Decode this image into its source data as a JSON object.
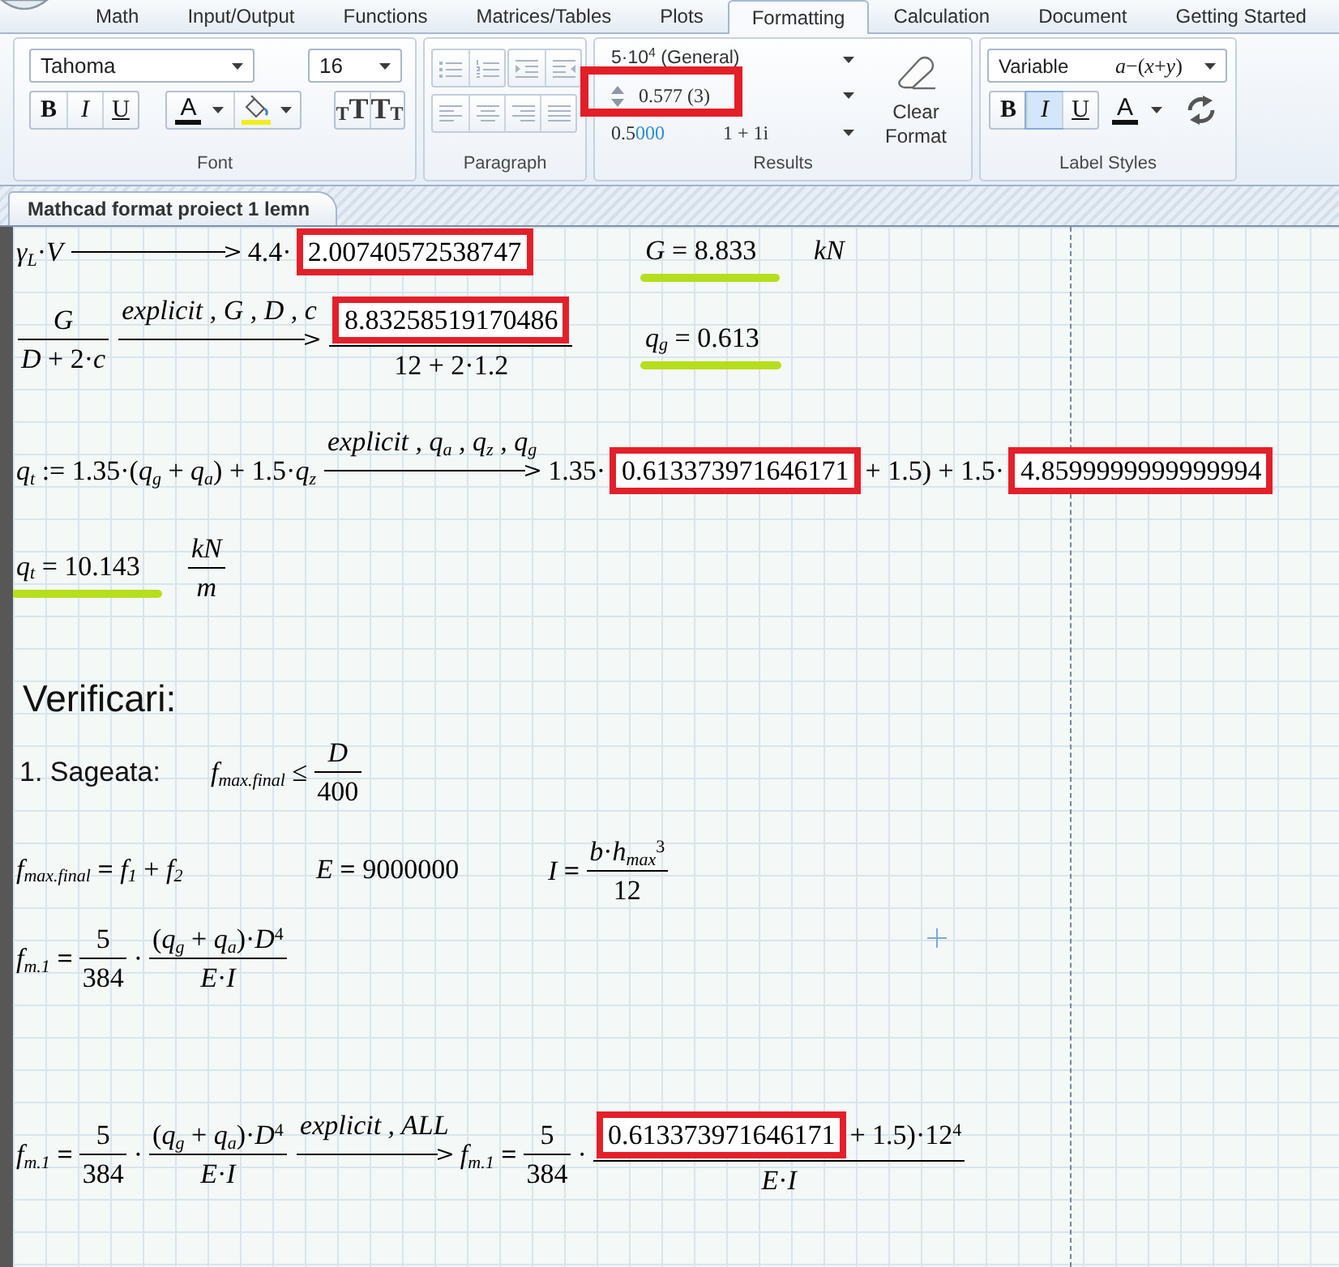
{
  "ribbon_tabs": [
    {
      "label": "Math",
      "selected": false
    },
    {
      "label": "Input/Output",
      "selected": false
    },
    {
      "label": "Functions",
      "selected": false
    },
    {
      "label": "Matrices/Tables",
      "selected": false
    },
    {
      "label": "Plots",
      "selected": false
    },
    {
      "label": "Formatting",
      "selected": true
    },
    {
      "label": "Calculation",
      "selected": false
    },
    {
      "label": "Document",
      "selected": false
    },
    {
      "label": "Getting Started",
      "selected": false
    }
  ],
  "ribbon": {
    "font": {
      "label": "Font",
      "font_name": "Tahoma",
      "font_size": "16",
      "styles": [
        {
          "kind": "bold",
          "label": "B",
          "on": false
        },
        {
          "kind": "italic",
          "label": "I",
          "on": false
        },
        {
          "kind": "underline",
          "label": "U",
          "on": false
        }
      ],
      "color_label": "A",
      "size_buttons": [
        {
          "kind": "grow",
          "label": "TT"
        },
        {
          "kind": "shrink",
          "label": "TT"
        }
      ]
    },
    "paragraph": {
      "label": "Paragraph",
      "disabled": true
    },
    "results": {
      "label": "Results",
      "format": "5·10$^{4}$ (General)",
      "precision": {
        "text": "0.577 (3)",
        "annotated": true
      },
      "sample": {
        "value": "0.5",
        "trailing_zeros": "000",
        "complex": "1 + 1i"
      },
      "clear_button": "Clear Format"
    },
    "label_styles": {
      "label": "Label Styles",
      "style_name": "Variable",
      "sample": "*a*−(*x*+*y*)",
      "styles": [
        {
          "kind": "bold",
          "label": "B",
          "on": false
        },
        {
          "kind": "italic",
          "label": "I",
          "on": true
        },
        {
          "kind": "underline",
          "label": "U",
          "on": false
        }
      ],
      "color_label": "A"
    }
  },
  "document_tab": {
    "title": "Mathcad format proiect 1 lemn"
  },
  "worksheet": {
    "rows": [
      {
        "regions": [
          {
            "kind": "math",
            "underlined": false,
            "parts": [
              {
                "kind": "t",
                "text": "*γ*$_{L}$·*V*"
              },
              {
                "kind": "arrow"
              },
              {
                "kind": "t",
                "text": "4.4·"
              },
              {
                "kind": "boxed",
                "text": "2.00740572538747"
              }
            ]
          },
          {
            "kind": "math",
            "underlined": true,
            "parts": [
              {
                "kind": "t",
                "text": "*G* = 8.833"
              }
            ]
          },
          {
            "kind": "math",
            "underlined": false,
            "parts": [
              {
                "kind": "var",
                "text": "kN"
              }
            ]
          }
        ]
      },
      {
        "regions": [
          {
            "kind": "math",
            "underlined": false,
            "parts": [
              {
                "kind": "frac",
                "num": [
                  {
                    "kind": "var",
                    "text": "G"
                  }
                ],
                "den": [
                  {
                    "kind": "t",
                    "text": "*D* + 2·*c*"
                  }
                ]
              },
              {
                "kind": "arrow",
                "label": "explicit , *G* , *D* , *c*"
              },
              {
                "kind": "frac",
                "num": [
                  {
                    "kind": "boxed",
                    "text": "8.83258519170486"
                  }
                ],
                "den": [
                  {
                    "kind": "t",
                    "text": "12 + 2·1.2"
                  }
                ]
              }
            ]
          },
          {
            "kind": "math",
            "underlined": true,
            "parts": [
              {
                "kind": "t",
                "text": "*q*$_{g}$ = 0.613"
              }
            ]
          }
        ]
      },
      {
        "regions": [
          {
            "kind": "math",
            "underlined": false,
            "parts": [
              {
                "kind": "t",
                "text": "*q*$_{t}$ := 1.35·(*q*$_{g}$ + *q*$_{a}$) + 1.5·*q*$_{z}$"
              },
              {
                "kind": "arrow",
                "label": "explicit , *q*$_{a}$ , *q*$_{z}$ , *q*$_{g}$"
              },
              {
                "kind": "t",
                "text": "1.35·"
              },
              {
                "kind": "boxed",
                "text": "0.613373971646171"
              },
              {
                "kind": "t",
                "text": "+ 1.5) + 1.5·"
              },
              {
                "kind": "boxed",
                "text": "4.8599999999999994"
              }
            ]
          }
        ]
      },
      {
        "regions": [
          {
            "kind": "math",
            "underlined": true,
            "parts": [
              {
                "kind": "t",
                "text": "*q*$_{t}$ = 10.143"
              }
            ]
          },
          {
            "kind": "math",
            "underlined": false,
            "parts": [
              {
                "kind": "frac",
                "num": [
                  {
                    "kind": "var",
                    "text": "kN"
                  }
                ],
                "den": [
                  {
                    "kind": "var",
                    "text": "m"
                  }
                ]
              }
            ]
          }
        ]
      },
      {
        "regions": [
          {
            "kind": "heading",
            "text": "Verificari:"
          }
        ]
      },
      {
        "regions": [
          {
            "kind": "label",
            "text": "1. Sageata:"
          },
          {
            "kind": "math",
            "underlined": false,
            "parts": [
              {
                "kind": "t",
                "text": "*f*$_{max.final}$ ≤"
              },
              {
                "kind": "frac",
                "num": [
                  {
                    "kind": "var",
                    "text": "D"
                  }
                ],
                "den": [
                  {
                    "kind": "t",
                    "text": "400"
                  }
                ]
              }
            ]
          }
        ]
      },
      {
        "regions": [
          {
            "kind": "math",
            "underlined": false,
            "parts": [
              {
                "kind": "t",
                "text": "*f*$_{max.final}$ **=** *f*$_{1}$ + *f*$_{2}$"
              }
            ]
          },
          {
            "kind": "math",
            "underlined": false,
            "parts": [
              {
                "kind": "t",
                "text": "*E* **=** 9000000"
              }
            ]
          },
          {
            "kind": "math",
            "underlined": false,
            "parts": [
              {
                "kind": "t",
                "text": "*I* **=**"
              },
              {
                "kind": "frac",
                "num": [
                  {
                    "kind": "t",
                    "text": "*b*·*h*$_{max}$$^{3}$"
                  }
                ],
                "den": [
                  {
                    "kind": "t",
                    "text": "12"
                  }
                ]
              }
            ]
          }
        ]
      },
      {
        "regions": [
          {
            "kind": "math",
            "underlined": false,
            "parts": [
              {
                "kind": "t",
                "text": "*f*$_{m.1}$ **=**"
              },
              {
                "kind": "frac",
                "num": [
                  {
                    "kind": "t",
                    "text": "5"
                  }
                ],
                "den": [
                  {
                    "kind": "t",
                    "text": "384"
                  }
                ]
              },
              {
                "kind": "t",
                "text": "·"
              },
              {
                "kind": "frac",
                "num": [
                  {
                    "kind": "t",
                    "text": "(*q*$_{g}$ + *q*$_{a}$)·*D*$^{4}$"
                  }
                ],
                "den": [
                  {
                    "kind": "t",
                    "text": "*E*·*I*"
                  }
                ]
              }
            ]
          }
        ]
      },
      {
        "regions": [
          {
            "kind": "math",
            "underlined": false,
            "parts": [
              {
                "kind": "t",
                "text": "*f*$_{m.1}$ **=**"
              },
              {
                "kind": "frac",
                "num": [
                  {
                    "kind": "t",
                    "text": "5"
                  }
                ],
                "den": [
                  {
                    "kind": "t",
                    "text": "384"
                  }
                ]
              },
              {
                "kind": "t",
                "text": "·"
              },
              {
                "kind": "frac",
                "num": [
                  {
                    "kind": "t",
                    "text": "(*q*$_{g}$ + *q*$_{a}$)·*D*$^{4}$"
                  }
                ],
                "den": [
                  {
                    "kind": "t",
                    "text": "*E*·*I*"
                  }
                ]
              },
              {
                "kind": "arrow",
                "label": "explicit , *ALL*"
              },
              {
                "kind": "t",
                "text": "*f*$_{m.1}$ **=**"
              },
              {
                "kind": "frac",
                "num": [
                  {
                    "kind": "t",
                    "text": "5"
                  }
                ],
                "den": [
                  {
                    "kind": "t",
                    "text": "384"
                  }
                ]
              },
              {
                "kind": "t",
                "text": "·"
              },
              {
                "kind": "frac",
                "num": [
                  {
                    "kind": "boxed",
                    "text": "0.613373971646171"
                  },
                  {
                    "kind": "t",
                    "text": "+ 1.5)·12$^{4}$"
                  }
                ],
                "den": [
                  {
                    "kind": "t",
                    "text": "*E*·*I*"
                  }
                ]
              }
            ]
          }
        ]
      }
    ]
  }
}
